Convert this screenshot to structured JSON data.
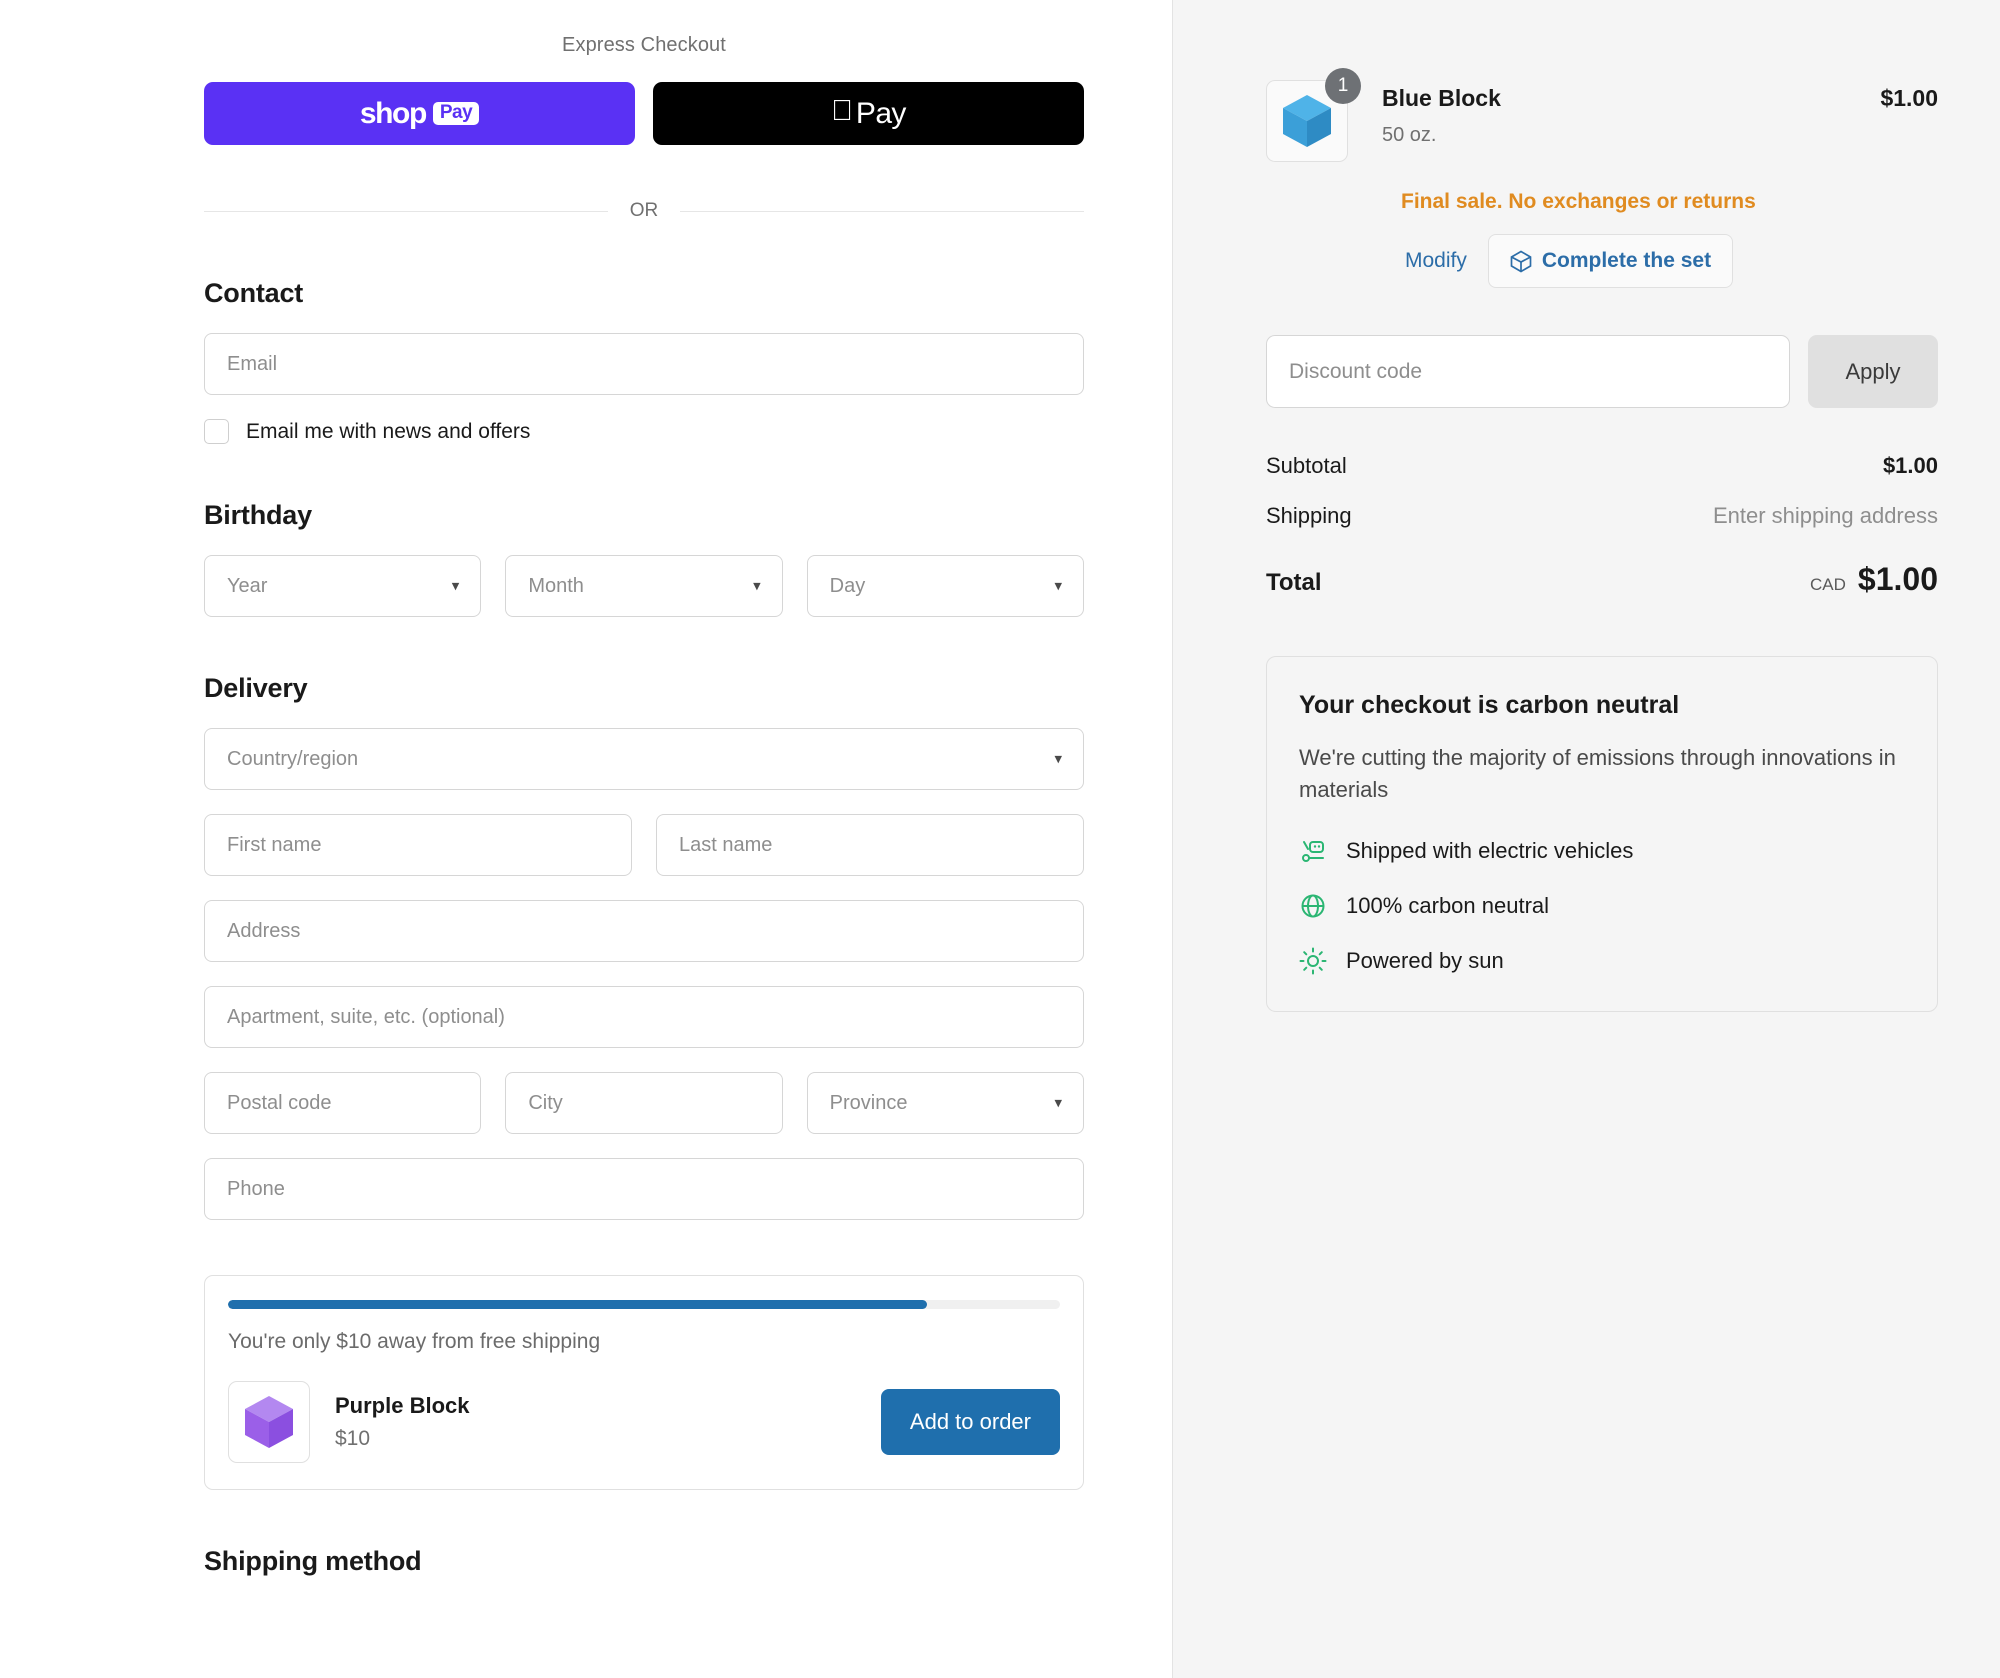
{
  "express": {
    "title": "Express Checkout",
    "shop_pay_label": "shop",
    "shop_pay_badge": "Pay",
    "apple_pay_label": "Pay",
    "divider_text": "OR"
  },
  "contact": {
    "heading": "Contact",
    "email_placeholder": "Email",
    "newsletter_label": "Email me with news and offers"
  },
  "birthday": {
    "heading": "Birthday",
    "year_placeholder": "Year",
    "month_placeholder": "Month",
    "day_placeholder": "Day"
  },
  "delivery": {
    "heading": "Delivery",
    "country_placeholder": "Country/region",
    "first_name_placeholder": "First name",
    "last_name_placeholder": "Last name",
    "address_placeholder": "Address",
    "apartment_placeholder": "Apartment, suite, etc. (optional)",
    "postal_placeholder": "Postal code",
    "city_placeholder": "City",
    "province_placeholder": "Province",
    "phone_placeholder": "Phone"
  },
  "upsell": {
    "progress_percent": 84,
    "message": "You're only $10 away from free shipping",
    "product_name": "Purple Block",
    "product_price": "$10",
    "add_button": "Add to order"
  },
  "shipping_method": {
    "heading": "Shipping method"
  },
  "summary": {
    "item": {
      "name": "Blue Block",
      "variant": "50 oz.",
      "price": "$1.00",
      "quantity": "1",
      "final_sale_notice": "Final sale. No exchanges or returns",
      "modify_label": "Modify",
      "complete_set_label": "Complete the set"
    },
    "discount_placeholder": "Discount code",
    "apply_label": "Apply",
    "subtotal_label": "Subtotal",
    "subtotal_value": "$1.00",
    "shipping_label": "Shipping",
    "shipping_value": "Enter shipping address",
    "total_label": "Total",
    "total_currency": "CAD",
    "total_value": "$1.00"
  },
  "carbon": {
    "title": "Your checkout is carbon neutral",
    "description": "We're cutting the majority of emissions through innovations in materials",
    "items": [
      {
        "icon": "electric-vehicle-icon",
        "label": "Shipped with electric vehicles"
      },
      {
        "icon": "globe-icon",
        "label": "100% carbon neutral"
      },
      {
        "icon": "sun-icon",
        "label": "Powered by sun"
      }
    ]
  },
  "colors": {
    "shop_pay_purple": "#5a31f4",
    "apple_pay_black": "#000000",
    "link_blue": "#2c6da8",
    "primary_blue": "#1f6fad",
    "final_sale_orange": "#e08b20",
    "carbon_green": "#2bb673",
    "panel_bg": "#f5f5f5"
  }
}
